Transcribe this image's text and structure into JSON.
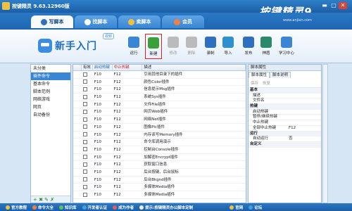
{
  "window": {
    "title": "按键精灵 9.63.12960版",
    "brand": "按键精灵9",
    "brand_url": "www.anjian.com"
  },
  "tabs": [
    {
      "label": "写脚本",
      "active": true
    },
    {
      "label": "找脚本",
      "active": false
    },
    {
      "label": "卖脚本",
      "active": false
    },
    {
      "label": "会员",
      "active": false
    }
  ],
  "logo": {
    "text": "新手入门",
    "badge": "视频"
  },
  "toolbar": [
    {
      "label": "运行",
      "icon": "run-icon",
      "color": "#3a86d4"
    },
    {
      "label": "新建",
      "icon": "new-icon",
      "color": "#3aa03a",
      "selected": true
    },
    {
      "label": "修改",
      "icon": "edit-icon",
      "color": "#bbbbbb",
      "disabled": true
    },
    {
      "label": "删除",
      "icon": "delete-icon",
      "color": "#bbbbbb",
      "disabled": true
    },
    {
      "label": "录制",
      "icon": "record-icon",
      "color": "#2f6fbf"
    },
    {
      "label": "导入",
      "icon": "import-icon",
      "color": "#2f8fcf"
    },
    {
      "label": "发布",
      "icon": "publish-icon",
      "color": "#2f6fbf"
    },
    {
      "label": "神盾",
      "icon": "shield-icon",
      "color": "#2a8a6a"
    },
    {
      "label": "学习中心",
      "icon": "learn-icon",
      "color": "#3a86d4"
    }
  ],
  "left_list": {
    "items": [
      "未分类",
      "插件命令",
      "基本命令",
      "脚本范例",
      "网络游戏",
      "网页",
      "自动备份"
    ],
    "selected_index": 1,
    "footer": "+ ✖ ✎ ✗"
  },
  "grid": {
    "columns": [
      "",
      "有效",
      "启动热键",
      "中止热键",
      "描述"
    ],
    "rows": [
      {
        "start": "F10",
        "stop": "F12",
        "desc": "引用其他目录下的插件"
      },
      {
        "start": "F10",
        "stop": "F12",
        "desc": "颜色Color插件"
      },
      {
        "start": "F10",
        "stop": "F12",
        "desc": "信息提示Msg插件"
      },
      {
        "start": "F10",
        "stop": "F12",
        "desc": "系统Sys插件"
      },
      {
        "start": "F10",
        "stop": "F12",
        "desc": "文件File插件"
      },
      {
        "start": "F10",
        "stop": "F12",
        "desc": "网页Web插件"
      },
      {
        "start": "F10",
        "stop": "F12",
        "desc": "网络Net插件"
      },
      {
        "start": "F10",
        "stop": "F12",
        "desc": "图像Pic插件"
      },
      {
        "start": "F10",
        "stop": "F12",
        "desc": "内存读写Memory插件"
      },
      {
        "start": "F10",
        "stop": "F12",
        "desc": "命令库调用演示"
      },
      {
        "start": "F10",
        "stop": "F12",
        "desc": "控制台Console插件"
      },
      {
        "start": "F10",
        "stop": "F12",
        "desc": "加解密Encrypt插件"
      },
      {
        "start": "F10",
        "stop": "F12",
        "desc": "获取窗口信息"
      },
      {
        "start": "F10",
        "stop": "F12",
        "desc": "后台按键、后台鼠标"
      },
      {
        "start": "F10",
        "stop": "F12",
        "desc": "后台Bkgnd插件"
      },
      {
        "start": "F10",
        "stop": "F12",
        "desc": "多媒体Media插件"
      },
      {
        "start": "F10",
        "stop": "F12",
        "desc": "多媒体Media插件"
      }
    ]
  },
  "props": {
    "header": "脚本属性",
    "tabs": [
      "脚本属性",
      "脚本说明"
    ],
    "tools": [
      "保存",
      "恢复"
    ],
    "rows": [
      {
        "k": "基本",
        "v": "",
        "section": true
      },
      {
        "k": "描述",
        "v": ""
      },
      {
        "k": "文件名",
        "v": ""
      },
      {
        "k": "热键",
        "v": "",
        "section": true
      },
      {
        "k": "启动热键",
        "v": ""
      },
      {
        "k": "暂停/继续热键",
        "v": ""
      },
      {
        "k": "中止热键",
        "v": ""
      },
      {
        "k": "全部中止热键",
        "v": "F12"
      },
      {
        "k": "运行",
        "v": "",
        "section": true
      },
      {
        "k": "自动运行",
        "v": "否"
      },
      {
        "k": "自定义",
        "v": "",
        "section": true
      }
    ]
  },
  "status": [
    {
      "label": "官方教程",
      "color": "#f0c040"
    },
    {
      "label": "命令大全",
      "color": "#f08040"
    },
    {
      "label": "知识库",
      "color": "#60c060"
    },
    {
      "label": "开发者认证",
      "color": "#40a0e0"
    },
    {
      "label": "成为作者",
      "color": "#e06060"
    },
    {
      "label": "提示:按键精灵办公脚本定制",
      "color": "#f0f0f0"
    },
    {
      "label": "官网",
      "color": "#f0c040"
    },
    {
      "label": "论坛",
      "color": "#40a0e0"
    }
  ]
}
